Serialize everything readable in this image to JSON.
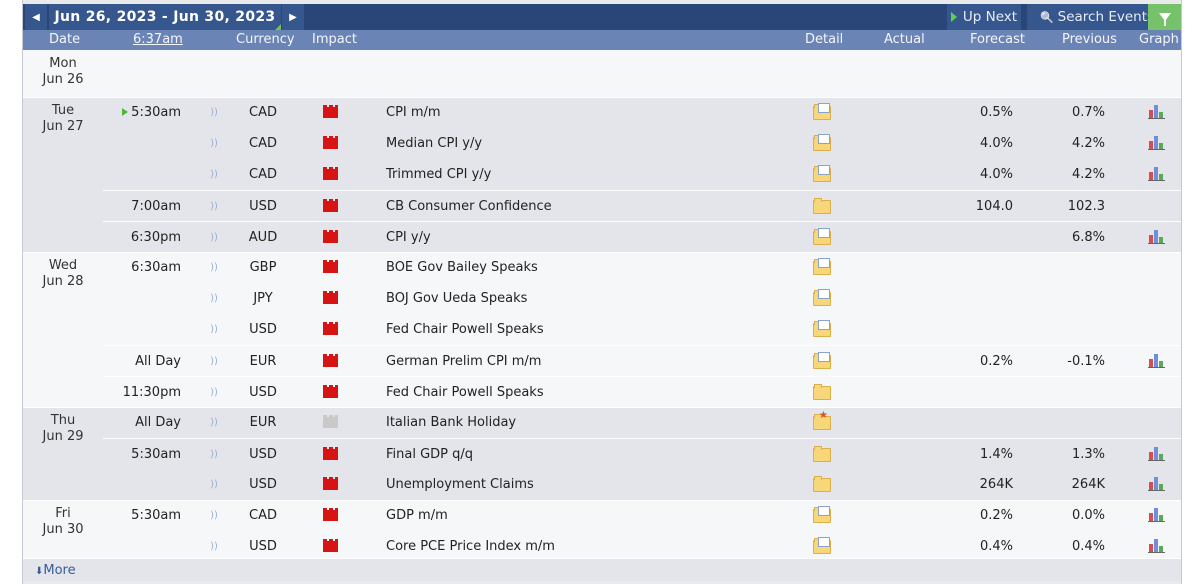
{
  "nav": {
    "prev_glyph": "◀",
    "next_glyph": "▶",
    "range_label": "Jun 26, 2023 - Jun 30, 2023",
    "up_next_label": "Up Next",
    "search_label": "Search Events",
    "search_glyph": "🔍"
  },
  "header": {
    "date": "Date",
    "time": "6:37am",
    "currency": "Currency",
    "impact": "Impact",
    "detail": "Detail",
    "actual": "Actual",
    "forecast": "Forecast",
    "previous": "Previous",
    "graph": "Graph"
  },
  "colors": {
    "high_impact": "#d61414",
    "holiday_impact": "#c9c9c9",
    "topbar": "#2a4577",
    "header": "#6a84b6",
    "filter": "#76c26a"
  },
  "days": [
    {
      "dow": "Mon",
      "date": "Jun 26"
    },
    {
      "dow": "Tue",
      "date": "Jun 27"
    },
    {
      "dow": "Wed",
      "date": "Jun 28"
    },
    {
      "dow": "Thu",
      "date": "Jun 29"
    },
    {
      "dow": "Fri",
      "date": "Jun 30"
    }
  ],
  "events": [
    {
      "time": "5:30am",
      "current": true,
      "currency": "CAD",
      "impact": "high",
      "name": "CPI m/m",
      "detail": "doc",
      "forecast": "0.5%",
      "previous": "0.7%",
      "graph": true
    },
    {
      "time": "",
      "currency": "CAD",
      "impact": "high",
      "name": "Median CPI y/y",
      "detail": "doc",
      "forecast": "4.0%",
      "previous": "4.2%",
      "graph": true
    },
    {
      "time": "",
      "currency": "CAD",
      "impact": "high",
      "name": "Trimmed CPI y/y",
      "detail": "doc",
      "forecast": "4.0%",
      "previous": "4.2%",
      "graph": true
    },
    {
      "time": "7:00am",
      "currency": "USD",
      "impact": "high",
      "name": "CB Consumer Confidence",
      "detail": "plain",
      "forecast": "104.0",
      "previous": "102.3",
      "graph": false
    },
    {
      "time": "6:30pm",
      "currency": "AUD",
      "impact": "high",
      "name": "CPI y/y",
      "detail": "doc",
      "forecast": "",
      "previous": "6.8%",
      "graph": true
    },
    {
      "time": "6:30am",
      "currency": "GBP",
      "impact": "high",
      "name": "BOE Gov Bailey Speaks",
      "detail": "doc",
      "forecast": "",
      "previous": "",
      "graph": false
    },
    {
      "time": "",
      "currency": "JPY",
      "impact": "high",
      "name": "BOJ Gov Ueda Speaks",
      "detail": "doc",
      "forecast": "",
      "previous": "",
      "graph": false
    },
    {
      "time": "",
      "currency": "USD",
      "impact": "high",
      "name": "Fed Chair Powell Speaks",
      "detail": "doc",
      "forecast": "",
      "previous": "",
      "graph": false
    },
    {
      "time": "All Day",
      "currency": "EUR",
      "impact": "high",
      "name": "German Prelim CPI m/m",
      "detail": "doc",
      "forecast": "0.2%",
      "previous": "-0.1%",
      "graph": true
    },
    {
      "time": "11:30pm",
      "currency": "USD",
      "impact": "high",
      "name": "Fed Chair Powell Speaks",
      "detail": "plain",
      "forecast": "",
      "previous": "",
      "graph": false
    },
    {
      "time": "All Day",
      "currency": "EUR",
      "impact": "holiday",
      "name": "Italian Bank Holiday",
      "detail": "star",
      "forecast": "",
      "previous": "",
      "graph": false
    },
    {
      "time": "5:30am",
      "currency": "USD",
      "impact": "high",
      "name": "Final GDP q/q",
      "detail": "plain",
      "forecast": "1.4%",
      "previous": "1.3%",
      "graph": true
    },
    {
      "time": "",
      "currency": "USD",
      "impact": "high",
      "name": "Unemployment Claims",
      "detail": "plain",
      "forecast": "264K",
      "previous": "264K",
      "graph": true
    },
    {
      "time": "5:30am",
      "currency": "CAD",
      "impact": "high",
      "name": "GDP m/m",
      "detail": "doc",
      "forecast": "0.2%",
      "previous": "0.0%",
      "graph": true
    },
    {
      "time": "",
      "currency": "USD",
      "impact": "high",
      "name": "Core PCE Price Index m/m",
      "detail": "doc",
      "forecast": "0.4%",
      "previous": "0.4%",
      "graph": true
    }
  ],
  "footer": {
    "more_label": "More",
    "more_glyph": "⬇"
  }
}
